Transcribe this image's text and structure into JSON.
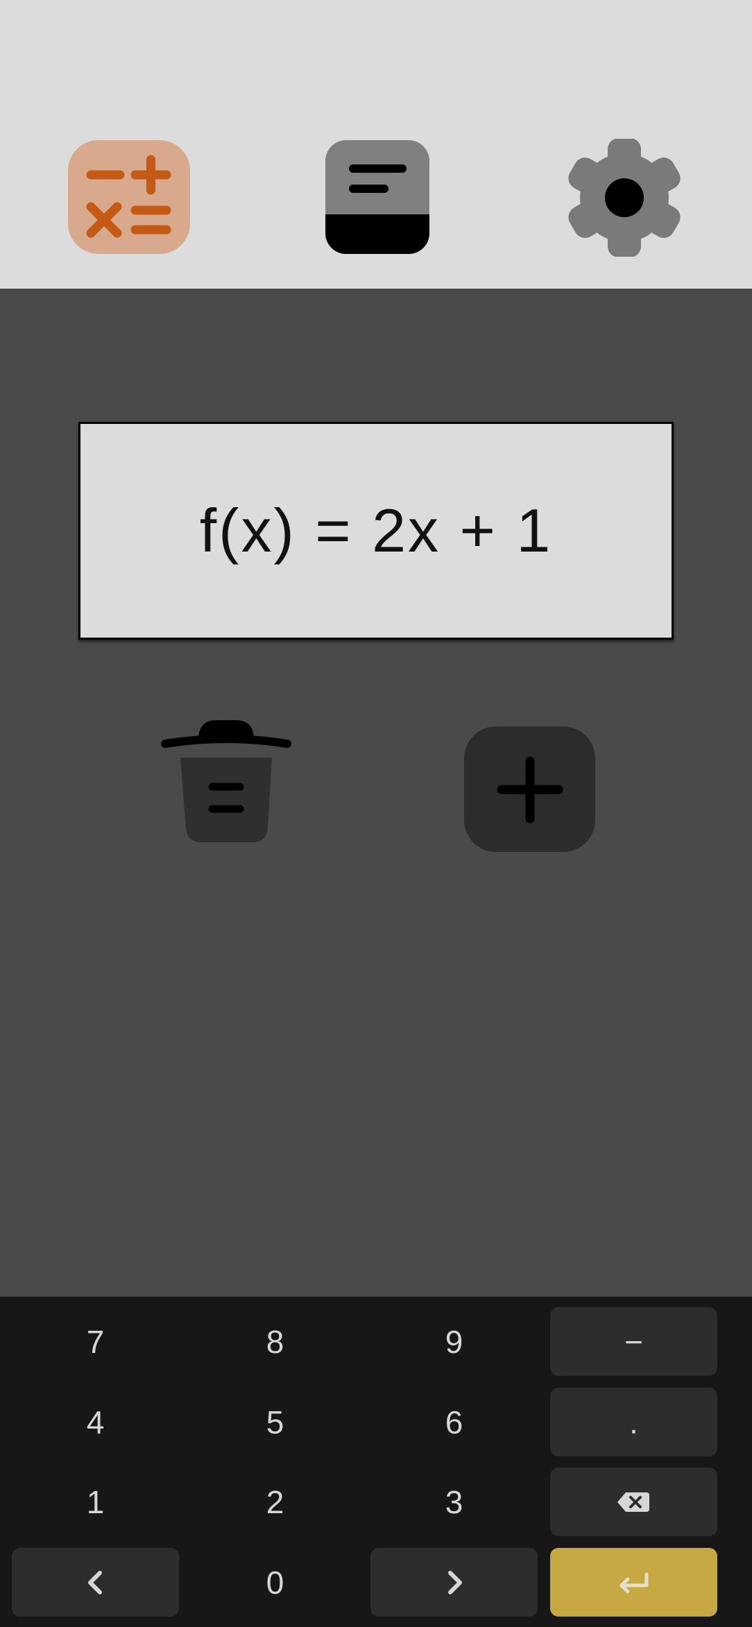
{
  "top_nav": {
    "calculator_icon": "calculator-ops-icon",
    "history_icon": "history-panel-icon",
    "settings_icon": "gear-icon"
  },
  "colors": {
    "calc_tile": "#d8a98c",
    "calc_glyph": "#c55a17",
    "enter_key": "#c8a843",
    "keypad_bg": "#171717",
    "key_dark": "#2d2d2d"
  },
  "expression": {
    "text": "f(x) = 2x + 1"
  },
  "actions": {
    "delete_icon": "trash-icon",
    "add_icon": "plus-icon"
  },
  "keypad": {
    "rows": [
      [
        "7",
        "8",
        "9",
        "−"
      ],
      [
        "4",
        "5",
        "6",
        "."
      ],
      [
        "1",
        "2",
        "3",
        "backspace-icon"
      ],
      [
        "chevron-left-icon",
        "0",
        "chevron-right-icon",
        "enter-icon"
      ]
    ]
  }
}
